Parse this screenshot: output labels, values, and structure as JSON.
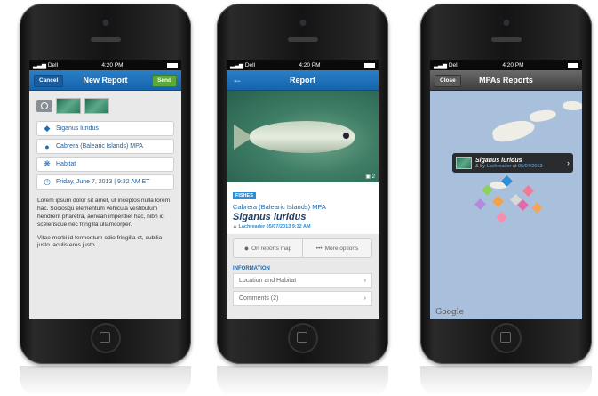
{
  "status_bar": {
    "carrier": "Dell",
    "time": "4:20 PM"
  },
  "screen1": {
    "cancel": "Cancel",
    "title": "New Report",
    "send": "Send",
    "species": "Siganus luridus",
    "location": "Cabrera (Balearic Islands) MPA",
    "habitat": "Habitat",
    "date": "Friday, June 7, 2013  |  9:32 AM ET",
    "para1": "Lorem ipsum dolor sit amet, ut inceptos nulla lorem hac. Sociosqu elementum vehicula vestibulum hendrerit pharetra, aenean imperdiet hac, nibh id scelerisque nec fringilla ullamcorper.",
    "para2": "Vitae morbi id fermentum odio fringilla et, cubilia justo iaculis eros justo."
  },
  "screen2": {
    "title": "Report",
    "photo_count": "2",
    "badge": "FISHES",
    "mpa": "Cabrera (Balearic Islands) MPA",
    "species": "Siganus luridus",
    "by_user": "Lachreader",
    "by_date": "05/07/2013",
    "by_time": "9:32 AM",
    "map_button": "On reports map",
    "more_button": "More options",
    "section": "INFORMATION",
    "row1": "Location and Habitat",
    "row2": "Comments (2)"
  },
  "screen3": {
    "close": "Close",
    "title": "MPAs Reports",
    "callout_title": "Siganus luridus",
    "callout_prefix": "& by",
    "callout_user": "Lachreader",
    "callout_mid": "at",
    "callout_date": "05/07/2013",
    "google": "Google"
  },
  "colors": {
    "accent": "#1a6fb9",
    "send": "#5aa93a",
    "map_water": "#a9c0dc"
  }
}
